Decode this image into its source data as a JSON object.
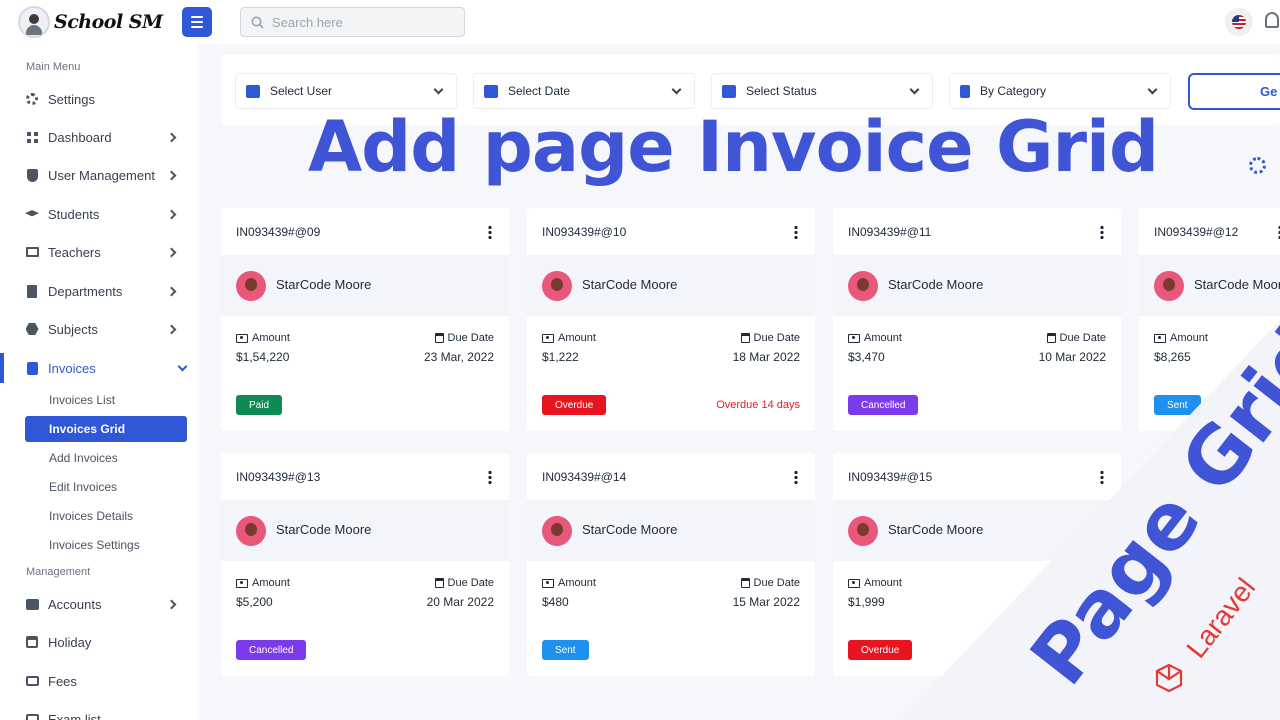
{
  "app": {
    "logo_text": "School SM"
  },
  "search": {
    "placeholder": "Search here"
  },
  "sidebar": {
    "main_menu_label": "Main Menu",
    "management_label": "Management",
    "items": [
      {
        "label": "Settings",
        "icon": "gear-icon"
      },
      {
        "label": "Dashboard",
        "icon": "dashboard-icon"
      },
      {
        "label": "User Management",
        "icon": "shield-icon"
      },
      {
        "label": "Students",
        "icon": "graduation-cap-icon"
      },
      {
        "label": "Teachers",
        "icon": "chalkboard-teacher-icon"
      },
      {
        "label": "Departments",
        "icon": "building-icon"
      },
      {
        "label": "Subjects",
        "icon": "cubes-icon"
      },
      {
        "label": "Invoices",
        "icon": "clipboard-icon"
      }
    ],
    "invoice_subitems": [
      "Invoices List",
      "Invoices Grid",
      "Add Invoices",
      "Edit Invoices",
      "Invoices Details",
      "Invoices Settings"
    ],
    "management_items": [
      {
        "label": "Accounts",
        "icon": "wallet-icon"
      },
      {
        "label": "Holiday",
        "icon": "calendar-icon"
      },
      {
        "label": "Fees",
        "icon": "card-icon"
      },
      {
        "label": "Exam list",
        "icon": "list-icon"
      }
    ]
  },
  "filters": {
    "user": "Select User",
    "date": "Select Date",
    "status": "Select Status",
    "category": "By Category",
    "generate": "Ge"
  },
  "overlay": {
    "headline": "Add page Invoice Grid",
    "ribbon_text": "Page Grid",
    "laravel": "Laravel"
  },
  "labels": {
    "amount": "Amount",
    "due_date": "Due Date"
  },
  "invoices": [
    {
      "id": "IN093439#@09",
      "user": "StarCode Moore",
      "amount": "$1,54,220",
      "due": "23 Mar, 2022",
      "status": "Paid",
      "note": ""
    },
    {
      "id": "IN093439#@10",
      "user": "StarCode Moore",
      "amount": "$1,222",
      "due": "18 Mar 2022",
      "status": "Overdue",
      "note": "Overdue 14 days"
    },
    {
      "id": "IN093439#@11",
      "user": "StarCode Moore",
      "amount": "$3,470",
      "due": "10 Mar 2022",
      "status": "Cancelled",
      "note": ""
    },
    {
      "id": "IN093439#@12",
      "user": "StarCode Moore",
      "amount": "$8,265",
      "due": "",
      "status": "Sent",
      "note": ""
    },
    {
      "id": "IN093439#@13",
      "user": "StarCode Moore",
      "amount": "$5,200",
      "due": "20 Mar 2022",
      "status": "Cancelled",
      "note": ""
    },
    {
      "id": "IN093439#@14",
      "user": "StarCode Moore",
      "amount": "$480",
      "due": "15 Mar 2022",
      "status": "Sent",
      "note": ""
    },
    {
      "id": "IN093439#@15",
      "user": "StarCode Moore",
      "amount": "$1,999",
      "due": "",
      "status": "Overdue",
      "note": ""
    }
  ],
  "status_colors": {
    "Paid": "#0f8a55",
    "Overdue": "#e8141f",
    "Cancelled": "#7c3aed",
    "Sent": "#1e90ee"
  }
}
